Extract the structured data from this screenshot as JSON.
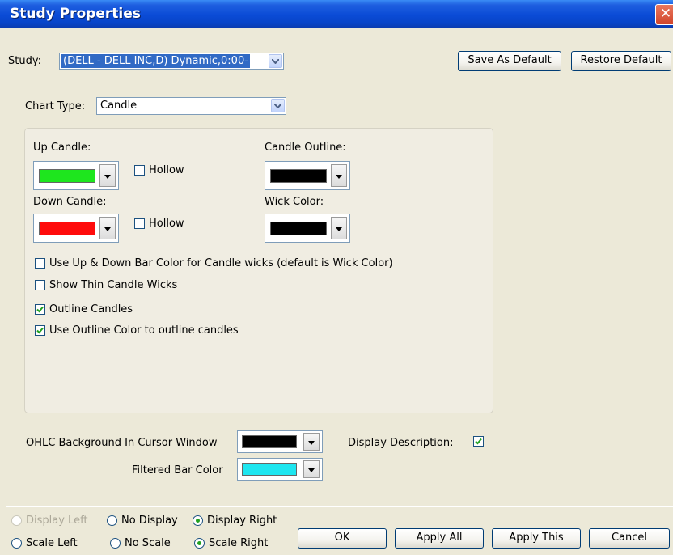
{
  "window": {
    "title": "Study Properties",
    "close_glyph": "✕"
  },
  "study": {
    "label": "Study:",
    "value": "(DELL - DELL INC,D) Dynamic,0:00-",
    "save_default": "Save As Default",
    "restore_default": "Restore Default"
  },
  "chart_type": {
    "label": "Chart Type:",
    "value": "Candle"
  },
  "candle": {
    "up_label": "Up Candle:",
    "up_color": "#1ee61e",
    "up_hollow": "Hollow",
    "down_label": "Down Candle:",
    "down_color": "#ff0b0b",
    "down_hollow": "Hollow",
    "outline_label": "Candle Outline:",
    "outline_color": "#000000",
    "wick_label": "Wick Color:",
    "wick_color": "#000000"
  },
  "options": [
    {
      "label": "Use Up & Down Bar Color for Candle wicks (default is Wick Color)",
      "checked": false
    },
    {
      "label": "Show Thin Candle Wicks",
      "checked": false
    },
    {
      "label": "Outline Candles",
      "checked": true
    },
    {
      "label": "Use Outline Color to outline candles",
      "checked": true
    }
  ],
  "ohlc": {
    "label": "OHLC Background In Cursor Window",
    "color": "#000000"
  },
  "filtered": {
    "label": "Filtered Bar Color",
    "color": "#1ee6f0"
  },
  "display_description": {
    "label": "Display Description:",
    "checked": true
  },
  "display_radios": [
    {
      "label": "Display Left",
      "selected": false,
      "disabled": true
    },
    {
      "label": "No Display",
      "selected": false,
      "disabled": false
    },
    {
      "label": "Display Right",
      "selected": true,
      "disabled": false
    }
  ],
  "scale_radios": [
    {
      "label": "Scale Left",
      "selected": false
    },
    {
      "label": "No Scale",
      "selected": false
    },
    {
      "label": "Scale Right",
      "selected": true
    }
  ],
  "buttons": {
    "ok": "OK",
    "apply_all": "Apply All",
    "apply_this": "Apply This",
    "cancel": "Cancel"
  }
}
